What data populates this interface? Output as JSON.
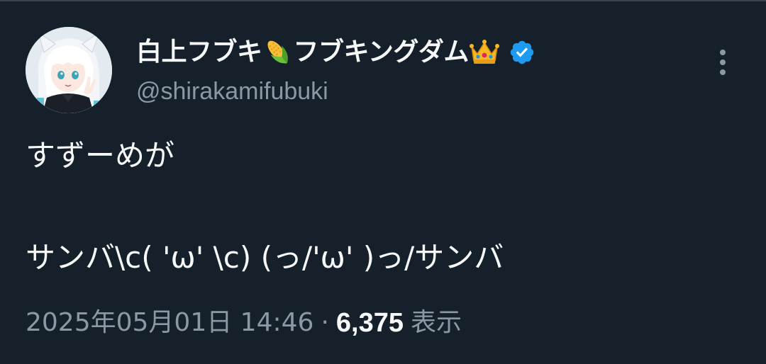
{
  "tweet": {
    "author": {
      "display_name_part1": "白上フブキ",
      "display_name_part2": "フブキングダム",
      "emoji_1": "corn-emoji",
      "emoji_2": "crown-emoji",
      "handle": "@shirakamifubuki",
      "verified": true,
      "avatar": "avatar-image"
    },
    "text_lines": [
      "すずーめが",
      "",
      "サンバ\\c( 'ω' \\c) (っ/'ω' )っ/サンバ"
    ],
    "timestamp": "2025年05月01日 14:46",
    "separator": "·",
    "view_count": "6,375",
    "view_label": "表示"
  },
  "colors": {
    "background": "#15202b",
    "text_primary": "#f7f9f9",
    "text_secondary": "#8b98a5",
    "verified_badge": "#1d9bf0"
  },
  "icons": {
    "more": "more-vertical-icon",
    "verified": "verified-badge-icon"
  }
}
